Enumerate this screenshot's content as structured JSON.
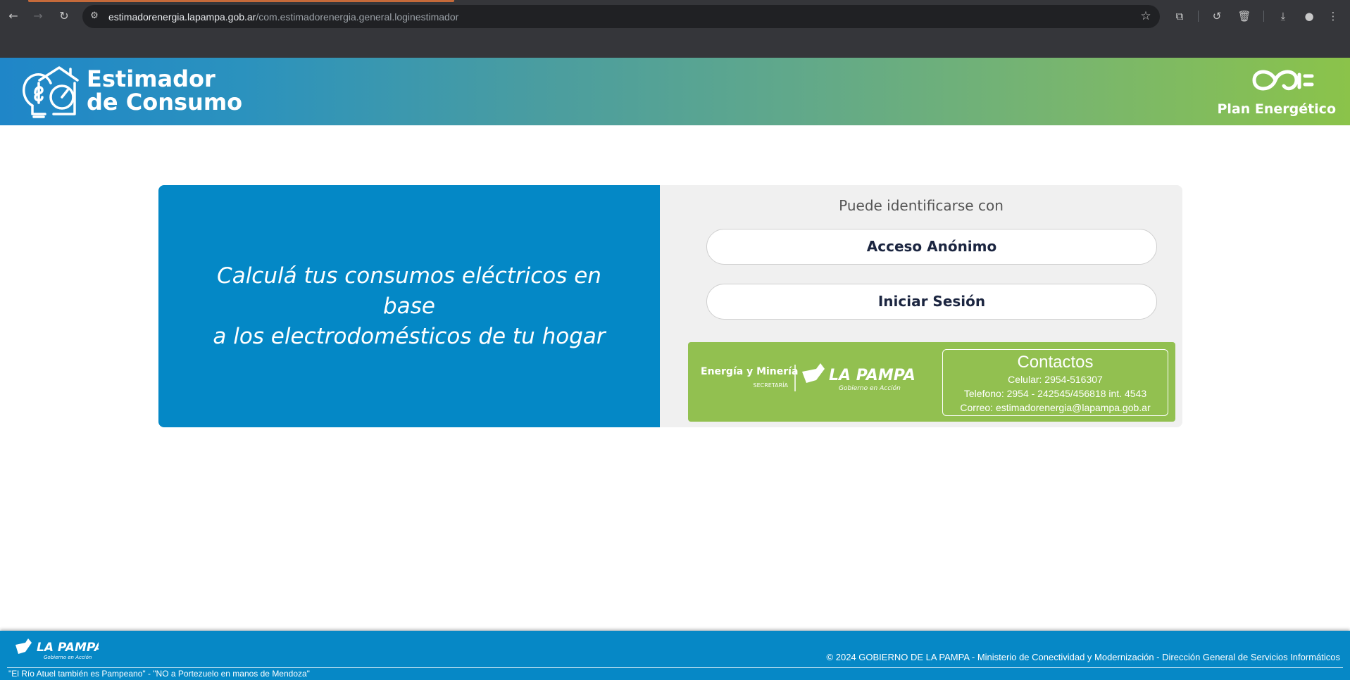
{
  "browser": {
    "url_host": "estimadorenergia.lapampa.gob.ar",
    "url_path": "/com.estimadorenergia.general.loginestimador",
    "icons": {
      "back": "back-arrow-icon",
      "forward": "forward-arrow-icon",
      "reload": "reload-icon",
      "site_info": "site-settings-icon",
      "bookmark": "star-icon",
      "extensions": "extensions-icon",
      "history": "history-icon",
      "delete": "trash-icon",
      "downloads": "download-icon",
      "profile": "profile-icon",
      "menu": "kebab-menu-icon"
    }
  },
  "header": {
    "title_line1": "Estimador",
    "title_line2": "de Consumo",
    "plan_label": "Plan Energético"
  },
  "hero": {
    "line1": "Calculá tus consumos eléctricos en base",
    "line2": "a los electrodomésticos de tu hogar"
  },
  "login": {
    "prompt": "Puede identificarse con",
    "anon_button": "Acceso Anónimo",
    "login_button": "Iniciar Sesión"
  },
  "logos": {
    "secretaria_line1": "Energía y Minería",
    "secretaria_line2": "SECRETARÍA",
    "province_name": "LA PAMPA",
    "province_motto": "Gobierno en Acción"
  },
  "contacts": {
    "title": "Contactos",
    "celular": "Celular: 2954-516307",
    "telefono": "Telefono: 2954 - 242545/456818 int. 4543",
    "correo": "Correo: estimadorenergia@lapampa.gob.ar"
  },
  "footer": {
    "logo_name": "LA PAMPA",
    "logo_motto": "Gobierno en Acción",
    "copyright": "© 2024 GOBIERNO DE LA PAMPA - Ministerio de Conectividad y Modernización - Dirección General de Servicios Informáticos",
    "slogan": "\"El Río Atuel también es Pampeano\" - \"NO a Portezuelo en manos de Mendoza\""
  },
  "colors": {
    "hero_blue": "#0488c6",
    "green_box": "#92c050",
    "footer_blue": "#0688c6",
    "button_text": "#1b2540"
  }
}
